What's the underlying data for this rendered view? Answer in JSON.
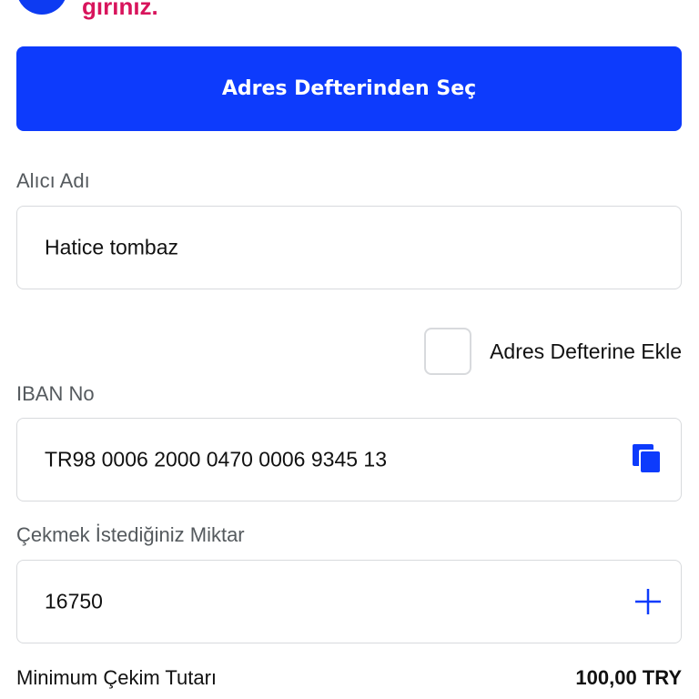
{
  "notice": {
    "text": "giriniz."
  },
  "address_book_button": {
    "label": "Adres Defterinden Seç"
  },
  "recipient": {
    "label": "Alıcı Adı",
    "value": "Hatice tombaz"
  },
  "add_to_address_book": {
    "label": "Adres Defterine Ekle",
    "checked": false
  },
  "iban": {
    "label": "IBAN No",
    "value": "TR98 0006 2000 0470 0006 9345 13"
  },
  "amount": {
    "label": "Çekmek İstediğiniz Miktar",
    "value": "16750"
  },
  "minimum": {
    "label": "Minimum Çekim Tutarı",
    "value": "100,00 TRY"
  },
  "colors": {
    "primary": "#0d3bfc",
    "notice": "#d8145c",
    "border": "#d8dadd"
  },
  "icons": {
    "copy": "copy-icon",
    "plus": "plus-icon"
  }
}
